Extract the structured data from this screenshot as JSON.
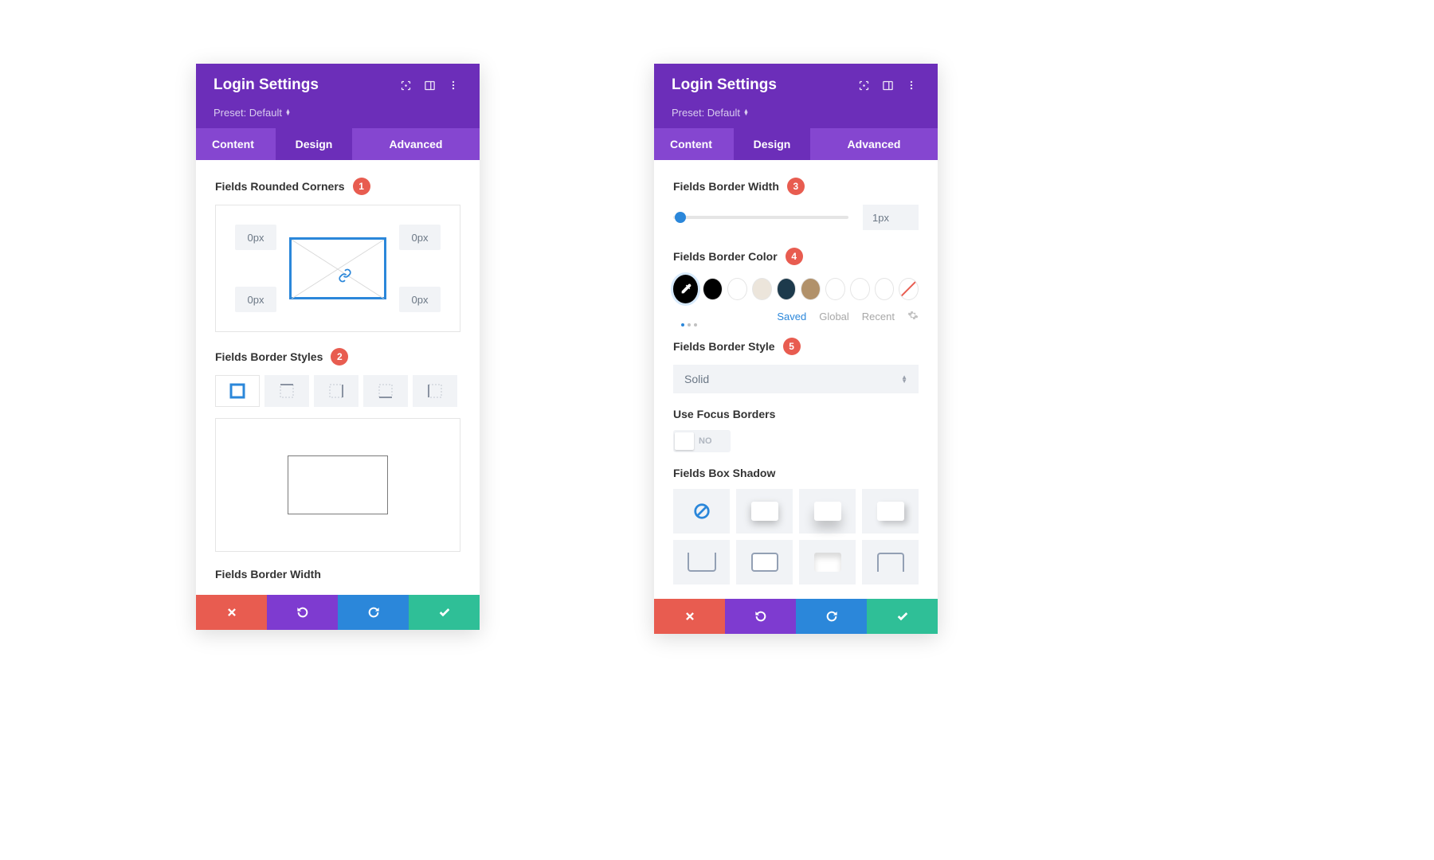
{
  "panels": {
    "a": {
      "title": "Login Settings",
      "preset": "Preset: Default",
      "tabs": {
        "content": "Content",
        "design": "Design",
        "advanced": "Advanced"
      },
      "sec_rc": "Fields Rounded Corners",
      "rc": {
        "tl": "0px",
        "tr": "0px",
        "bl": "0px",
        "br": "0px"
      },
      "sec_bs": "Fields Border Styles",
      "sec_bw": "Fields Border Width",
      "callouts": {
        "rc": "1",
        "bs": "2"
      }
    },
    "b": {
      "title": "Login Settings",
      "preset": "Preset: Default",
      "tabs": {
        "content": "Content",
        "design": "Design",
        "advanced": "Advanced"
      },
      "sec_bw": "Fields Border Width",
      "bw_value": "1px",
      "sec_bc": "Fields Border Color",
      "color_tabs": {
        "saved": "Saved",
        "global": "Global",
        "recent": "Recent"
      },
      "sec_bstyle": "Fields Border Style",
      "bstyle_value": "Solid",
      "sec_focus": "Use Focus Borders",
      "focus_value": "NO",
      "sec_shadow": "Fields Box Shadow",
      "callouts": {
        "bw": "3",
        "bc": "4",
        "bstyle": "5"
      },
      "swatches": [
        "#000000",
        "#000000",
        "#ffffff",
        "#ece5db",
        "#1d3a4c",
        "#b1916a",
        "#ffffff",
        "#ffffff",
        "#ffffff"
      ]
    }
  }
}
